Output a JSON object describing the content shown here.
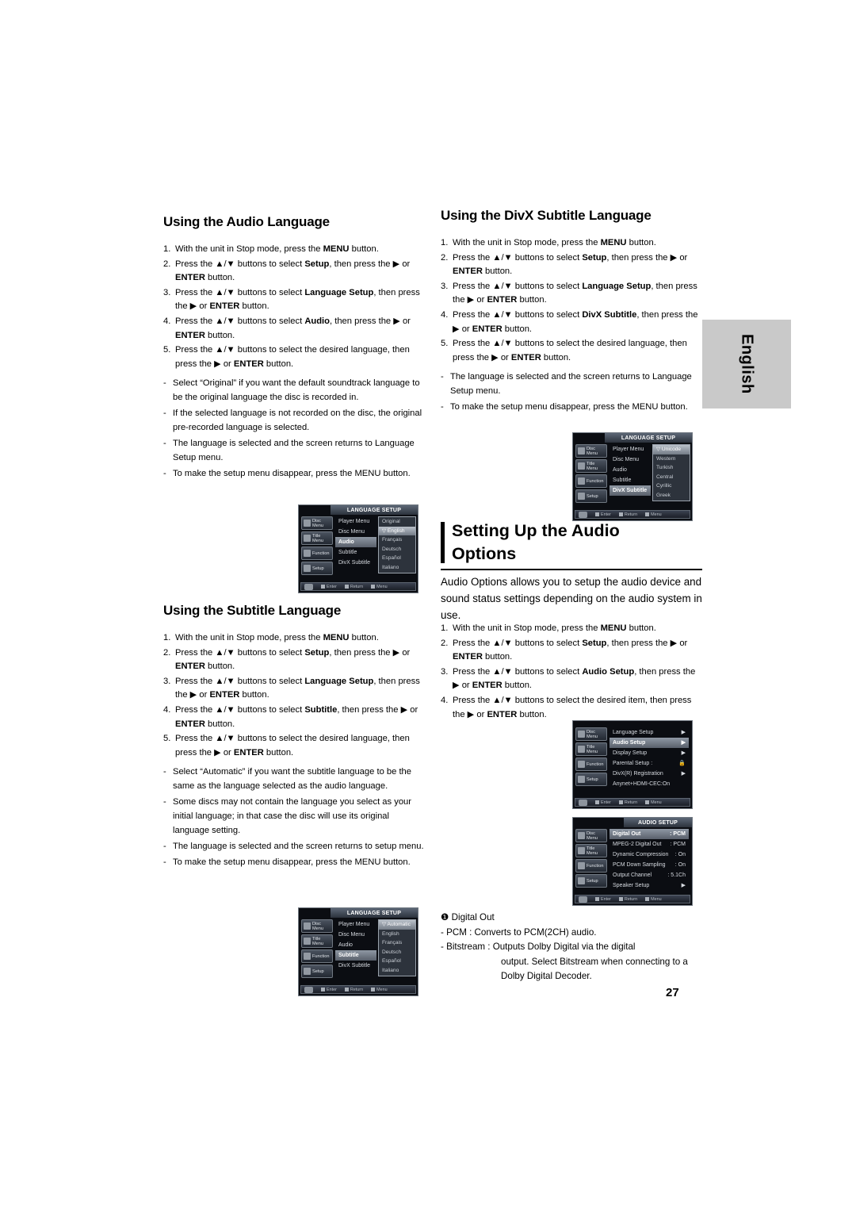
{
  "page": {
    "number": "27",
    "side_tab": "English"
  },
  "sections": {
    "audio_language": {
      "title": "Using the Audio Language",
      "steps": [
        {
          "num": "1.",
          "html": "With the unit in Stop mode, press the <b>MENU</b> button."
        },
        {
          "num": "2.",
          "html": "Press the ▲/▼ buttons to select <b>Setup</b>, then press the ▶ or <b>ENTER</b> button."
        },
        {
          "num": "3.",
          "html": "Press the ▲/▼ buttons to select <b>Language Setup</b>, then press the ▶ or <b>ENTER</b> button."
        },
        {
          "num": "4.",
          "html": "Press the ▲/▼ buttons to select <b>Audio</b>, then press the ▶ or <b>ENTER</b> button."
        },
        {
          "num": "5.",
          "html": "Press the ▲/▼ buttons to select the desired language, then press the ▶ or <b>ENTER</b> button."
        }
      ],
      "bullets": [
        "Select “Original” if you want the default soundtrack language to be the original language the disc is recorded in.",
        "If the selected language is not recorded on the disc, the original pre-recorded language is selected.",
        "The language is selected and the screen returns to Language Setup menu.",
        "To make the setup menu disappear, press the MENU button."
      ]
    },
    "subtitle_language": {
      "title": "Using the Subtitle Language",
      "steps": [
        {
          "num": "1.",
          "html": "With the unit in Stop mode, press the <b>MENU</b> button."
        },
        {
          "num": "2.",
          "html": "Press the ▲/▼ buttons to select <b>Setup</b>, then press the ▶ or <b>ENTER</b> button."
        },
        {
          "num": "3.",
          "html": "Press the ▲/▼ buttons to select <b>Language Setup</b>, then press the ▶ or <b>ENTER</b> button."
        },
        {
          "num": "4.",
          "html": "Press the ▲/▼ buttons to select <b>Subtitle</b>, then press the ▶ or <b>ENTER</b> button."
        },
        {
          "num": "5.",
          "html": "Press the ▲/▼ buttons to select the desired  language, then press the ▶ or <b>ENTER</b> button."
        }
      ],
      "bullets": [
        "Select “Automatic” if you want the subtitle  language to be the same as the language selected as the audio language.",
        "Some discs may not contain the language you select as your initial language; in that case the disc will use its original language setting.",
        "The language is selected and the screen returns to setup menu.",
        "To make the setup menu disappear, press the MENU button."
      ]
    },
    "divx_subtitle_language": {
      "title": "Using the DivX Subtitle Language",
      "steps": [
        {
          "num": "1.",
          "html": "With the unit in Stop mode, press the <b>MENU</b> button."
        },
        {
          "num": "2.",
          "html": "Press the ▲/▼ buttons to select <b>Setup</b>, then press the ▶ or <b>ENTER</b> button."
        },
        {
          "num": "3.",
          "html": "Press the ▲/▼ buttons to select <b>Language Setup</b>, then press the ▶ or <b>ENTER</b> button."
        },
        {
          "num": "4.",
          "html": "Press the ▲/▼ buttons to select <b>DivX Subtitle</b>, then press the ▶ or <b>ENTER</b> button."
        },
        {
          "num": "5.",
          "html": "Press the ▲/▼ buttons to select the desired  language, then press the ▶ or <b>ENTER</b> button."
        }
      ],
      "bullets": [
        "The language is selected and the screen returns to Language Setup menu.",
        "To make the setup menu disappear, press the MENU button."
      ]
    },
    "audio_options": {
      "title_line1": "Setting Up the Audio",
      "title_line2": "Options",
      "intro": "Audio Options allows you to setup the audio device and sound status settings depending on the audio system in use.",
      "steps": [
        {
          "num": "1.",
          "html": "With the unit in Stop mode, press the <b>MENU</b> button."
        },
        {
          "num": "2.",
          "html": "Press the ▲/▼ buttons to select <b>Setup</b>, then press the ▶ or <b>ENTER</b> button."
        },
        {
          "num": "3.",
          "html": "Press the ▲/▼ buttons to select <b>Audio Setup</b>, then press the ▶ or <b>ENTER</b> button."
        },
        {
          "num": "4.",
          "html": "Press the ▲/▼ buttons to select the desired item, then press the ▶ or <b>ENTER</b> button."
        }
      ],
      "digital_out": {
        "heading": "❶ Digital Out",
        "lines": [
          "- PCM : Converts to PCM(2CH) audio.",
          "- Bitstream : Outputs Dolby Digital via the digital"
        ],
        "indented": [
          "output. Select Bitstream when connecting to a",
          "Dolby Digital Decoder."
        ]
      }
    }
  },
  "osd": {
    "left_buttons": [
      "Disc Menu",
      "Title Menu",
      "Function",
      "Setup"
    ],
    "footer": {
      "enter": "Enter",
      "return": "Return",
      "menu": "Menu"
    },
    "audio_screen": {
      "title": "LANGUAGE SETUP",
      "rows": [
        "Player Menu",
        "Disc Menu",
        "Audio",
        "Subtitle",
        "DivX Subtitle"
      ],
      "selected_row": "Audio",
      "options": [
        "Original",
        "English",
        "Français",
        "Deutsch",
        "Español",
        "Italiano"
      ],
      "selected_option": "English"
    },
    "subtitle_screen": {
      "title": "LANGUAGE SETUP",
      "rows": [
        "Player Menu",
        "Disc Menu",
        "Audio",
        "Subtitle",
        "DivX Subtitle"
      ],
      "selected_row": "Subtitle",
      "options": [
        "Automatic",
        "English",
        "Français",
        "Deutsch",
        "Español",
        "Italiano"
      ],
      "selected_option": "Automatic"
    },
    "divx_screen": {
      "title": "LANGUAGE SETUP",
      "rows": [
        "Player Menu",
        "Disc Menu",
        "Audio",
        "Subtitle",
        "DivX Subtitle"
      ],
      "selected_row": "DivX Subtitle",
      "options": [
        "Unicode",
        "Western",
        "Turkish",
        "Central",
        "Cyrillic",
        "Greek"
      ],
      "selected_option": "Unicode"
    },
    "setup_screen": {
      "rows": [
        {
          "label": "Language Setup",
          "value": "▶"
        },
        {
          "label": "Audio Setup",
          "value": "▶"
        },
        {
          "label": "Display Setup",
          "value": "▶"
        },
        {
          "label": "Parental Setup :",
          "value": "🔒"
        },
        {
          "label": "DivX(R) Registration",
          "value": "▶"
        },
        {
          "label": "Anynet+HDMI-CEC:On",
          "value": ""
        }
      ],
      "selected_row": "Audio Setup"
    },
    "audio_setup_screen": {
      "title": "AUDIO SETUP",
      "rows": [
        {
          "label": "Digital Out",
          "value": ": PCM"
        },
        {
          "label": "MPEG-2 Digital Out",
          "value": ": PCM"
        },
        {
          "label": "Dynamic Compression",
          "value": ": On"
        },
        {
          "label": "PCM Down Sampling",
          "value": ": On"
        },
        {
          "label": "Output Channel",
          "value": ": 5.1Ch"
        },
        {
          "label": "Speaker Setup",
          "value": "▶"
        }
      ],
      "selected_row": "Digital Out"
    }
  }
}
